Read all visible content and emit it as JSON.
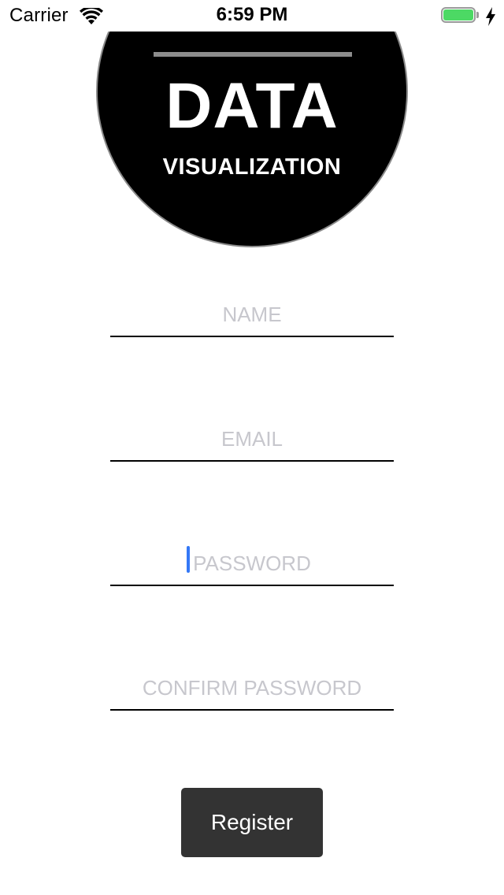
{
  "status_bar": {
    "carrier": "Carrier",
    "time": "6:59 PM",
    "battery_color": "#4cd964",
    "wifi_icon": "wifi-icon",
    "battery_icon": "battery-icon",
    "charging_icon": "charging-bolt-icon"
  },
  "logo": {
    "title": "DATA",
    "subtitle": "VISUALIZATION"
  },
  "form": {
    "name_placeholder": "NAME",
    "email_placeholder": "EMAIL",
    "password_placeholder": "PASSWORD",
    "confirm_placeholder": "CONFIRM PASSWORD",
    "placeholder_color": "#c7c7cd",
    "caret_color": "#3478f6"
  },
  "register": {
    "label": "Register",
    "background": "#333333"
  }
}
